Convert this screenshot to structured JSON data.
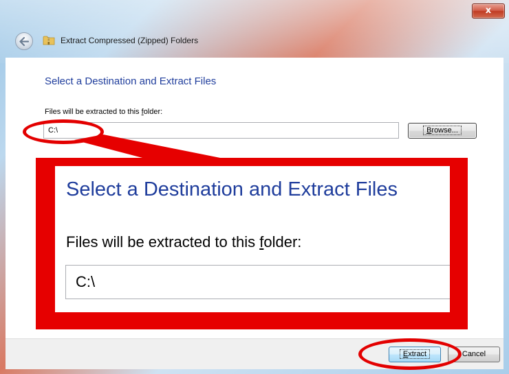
{
  "window": {
    "title": "Extract Compressed (Zipped) Folders",
    "close_glyph": "x",
    "back_icon": "back-arrow-icon",
    "folder_icon": "zip-folder-icon"
  },
  "main": {
    "heading": "Select a Destination and Extract Files",
    "label_before": "Files will be extracted to this ",
    "label_accel": "f",
    "label_after": "older:",
    "path_value": "C:\\",
    "browse_accel": "B",
    "browse_rest": "rowse..."
  },
  "callout": {
    "heading": "Select a Destination and Extract Files",
    "label_before": "Files will be extracted to this ",
    "label_accel": "f",
    "label_after": "older:",
    "path_value": "C:\\"
  },
  "footer": {
    "extract_accel": "E",
    "extract_rest": "xtract",
    "cancel_label": "Cancel"
  },
  "colors": {
    "annotation_red": "#e30000",
    "heading_blue": "#1f3d9c"
  }
}
